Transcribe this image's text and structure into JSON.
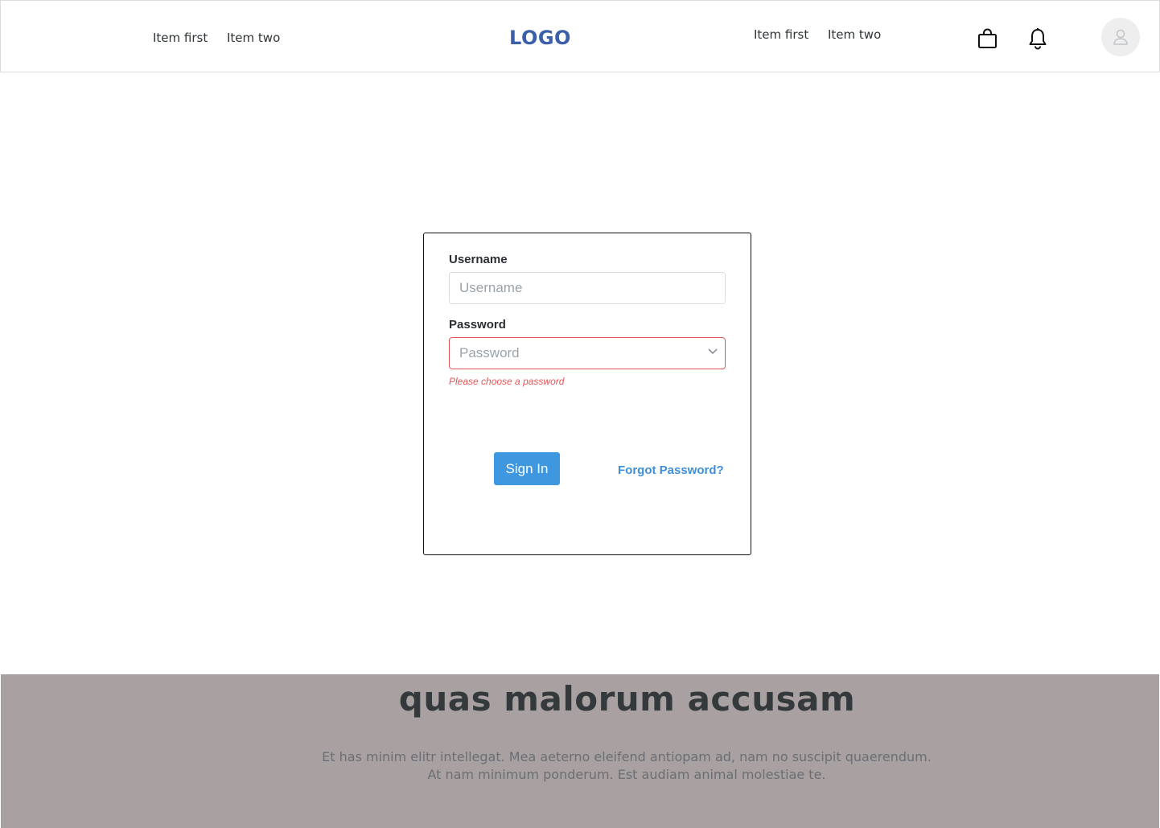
{
  "header": {
    "left_nav": [
      {
        "label": "Item first"
      },
      {
        "label": "Item two"
      }
    ],
    "logo": "LOGO",
    "right_nav": [
      {
        "label": "Item first"
      },
      {
        "label": "Item two"
      }
    ],
    "icons": [
      "shopping-bag-icon",
      "bell-icon",
      "user-icon"
    ]
  },
  "login": {
    "username_label": "Username",
    "username_placeholder": "Username",
    "username_value": "",
    "password_label": "Password",
    "password_placeholder": "Password",
    "password_value": "",
    "password_error": "Please choose a password",
    "sign_in_label": "Sign In",
    "forgot_label": "Forgot Password?"
  },
  "hero": {
    "title": "quas malorum accusam",
    "text_line1": "Et has minim elitr intellegat. Mea aeterno eleifend antiopam ad, nam no suscipit quaerendum.",
    "text_line2": "At nam minimum ponderum. Est audiam animal molestiae te."
  },
  "colors": {
    "logo": "#3b5fa8",
    "primary_button": "#3f97df",
    "link": "#3f8fd6",
    "error": "#e35656",
    "hero_background": "#a8a0a1"
  }
}
